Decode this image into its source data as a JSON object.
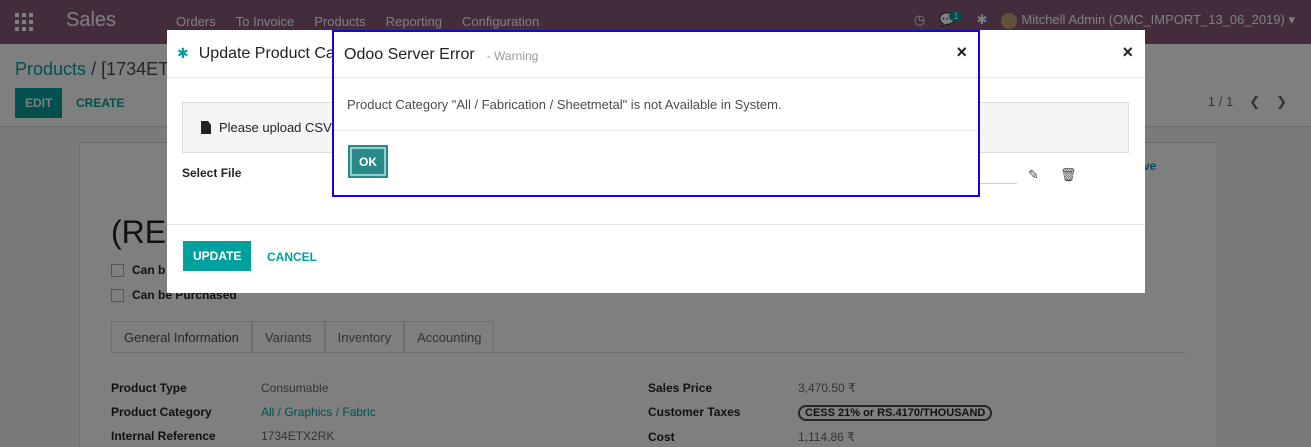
{
  "navbar": {
    "brand": "Sales",
    "menu": [
      "Orders",
      "To Invoice",
      "Products",
      "Reporting",
      "Configuration"
    ],
    "notification_count": "1",
    "user": "Mitchell Admin (OMC_IMPORT_13_06_2019)"
  },
  "control": {
    "breadcrumb_root": "Products",
    "breadcrumb_sep": "/",
    "breadcrumb_current": "[1734ET",
    "edit_label": "EDIT",
    "create_label": "CREATE",
    "pager": "1 / 1"
  },
  "form": {
    "title": "(REF",
    "can_be_sold": "Can b",
    "can_be_purchased": "Can be Purchased",
    "tabs": [
      "General Information",
      "Variants",
      "Inventory",
      "Accounting"
    ],
    "fields_left": [
      {
        "label": "Product Type",
        "value": "Consumable"
      },
      {
        "label": "Product Category",
        "value": "All / Graphics / Fabric"
      },
      {
        "label": "Internal Reference",
        "value": "1734ETX2RK"
      }
    ],
    "fields_right": [
      {
        "label": "Sales Price",
        "value": "3,470.50 ₹"
      },
      {
        "label": "Customer Taxes",
        "value": "CESS 21% or RS.4170/THOUSAND"
      },
      {
        "label": "Cost",
        "value": "1,114.86 ₹"
      }
    ],
    "archive_hint": "ve"
  },
  "update_dialog": {
    "title": "Update Product Ca",
    "upload_text": "Please upload CSV",
    "select_file_label": "Select File",
    "update_label": "UPDATE",
    "cancel_label": "CANCEL",
    "close": "×"
  },
  "error_dialog": {
    "title": "Odoo Server Error",
    "subtitle": "- Warning",
    "message": "Product Category \"All / Fabrication / Sheetmetal\" is not Available in System.",
    "ok_label": "OK",
    "close": "×"
  }
}
